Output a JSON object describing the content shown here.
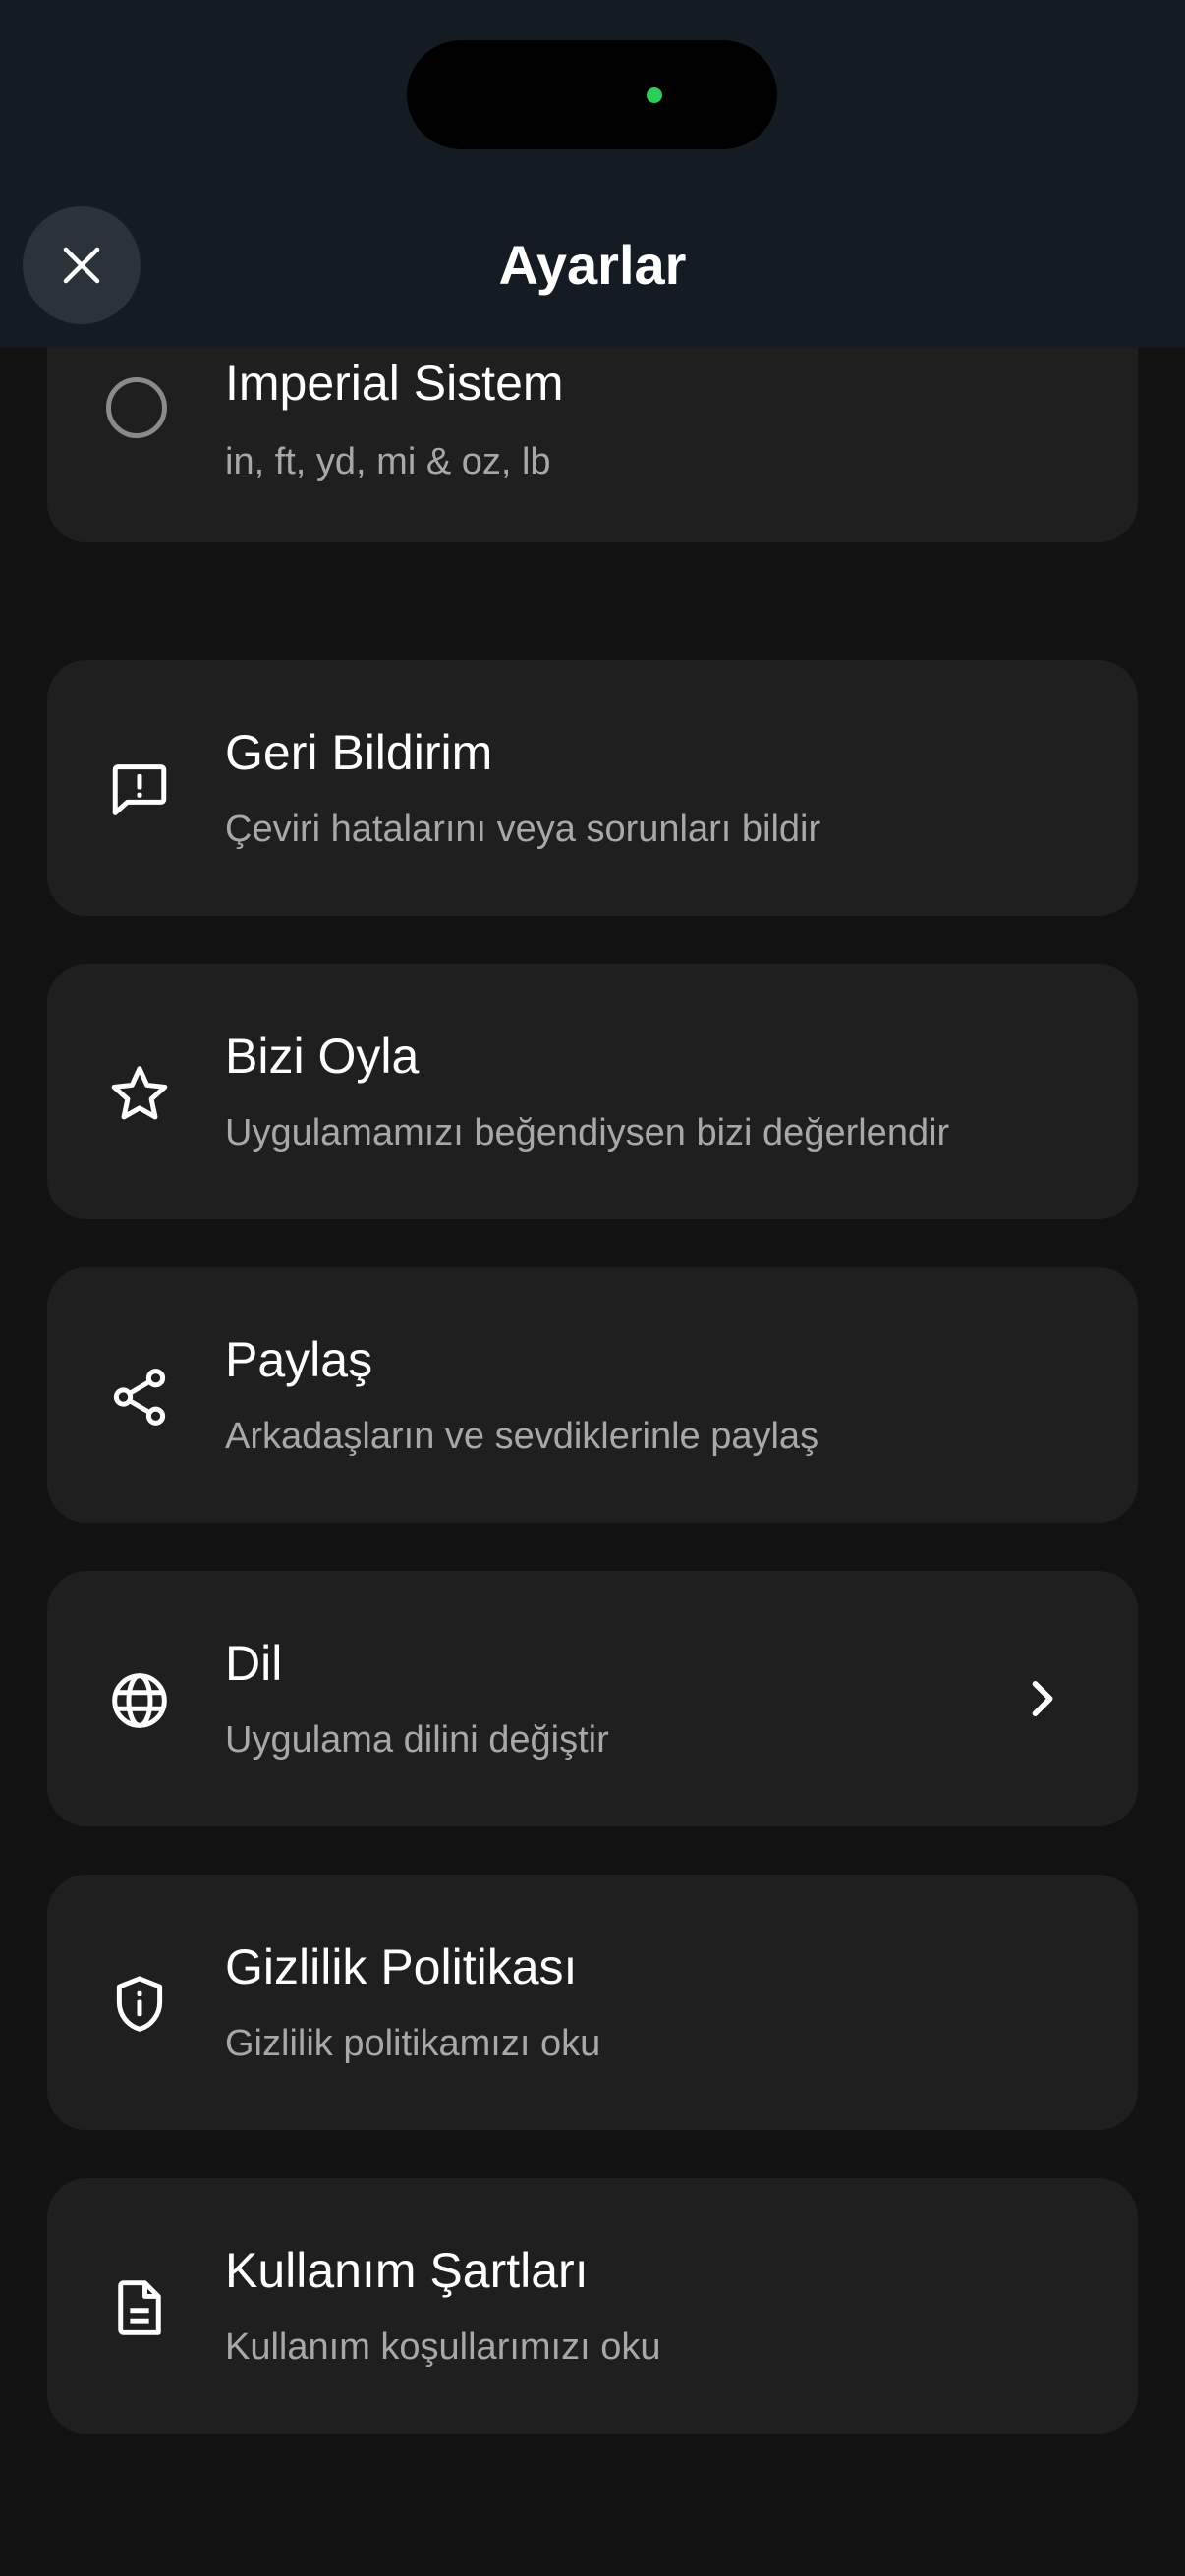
{
  "header": {
    "title": "Ayarlar",
    "close_icon": "close-icon"
  },
  "unit_option": {
    "title": "Imperial Sistem",
    "subtitle": "in, ft, yd, mi & oz, lb",
    "selected": false
  },
  "settings": [
    {
      "id": "feedback",
      "icon": "feedback-icon",
      "title": "Geri Bildirim",
      "subtitle": "Çeviri hatalarını veya sorunları bildir"
    },
    {
      "id": "rate",
      "icon": "star-icon",
      "title": "Bizi Oyla",
      "subtitle": "Uygulamamızı beğendiysen bizi değerlendir"
    },
    {
      "id": "share",
      "icon": "share-icon",
      "title": "Paylaş",
      "subtitle": "Arkadaşların ve sevdiklerinle paylaş"
    },
    {
      "id": "language",
      "icon": "globe-icon",
      "title": "Dil",
      "subtitle": "Uygulama dilini değiştir",
      "has_chevron": true
    },
    {
      "id": "privacy",
      "icon": "shield-info-icon",
      "title": "Gizlilik Politikası",
      "subtitle": "Gizlilik politikamızı oku"
    },
    {
      "id": "terms",
      "icon": "document-icon",
      "title": "Kullanım Şartları",
      "subtitle": "Kullanım koşullarımızı oku"
    }
  ],
  "colors": {
    "background": "#121212",
    "header": "#141b23",
    "card": "#1f1f1f",
    "title_text": "#ffffff",
    "subtitle_text": "#a8a8a8",
    "indicator_dot": "#2ecc5c"
  }
}
